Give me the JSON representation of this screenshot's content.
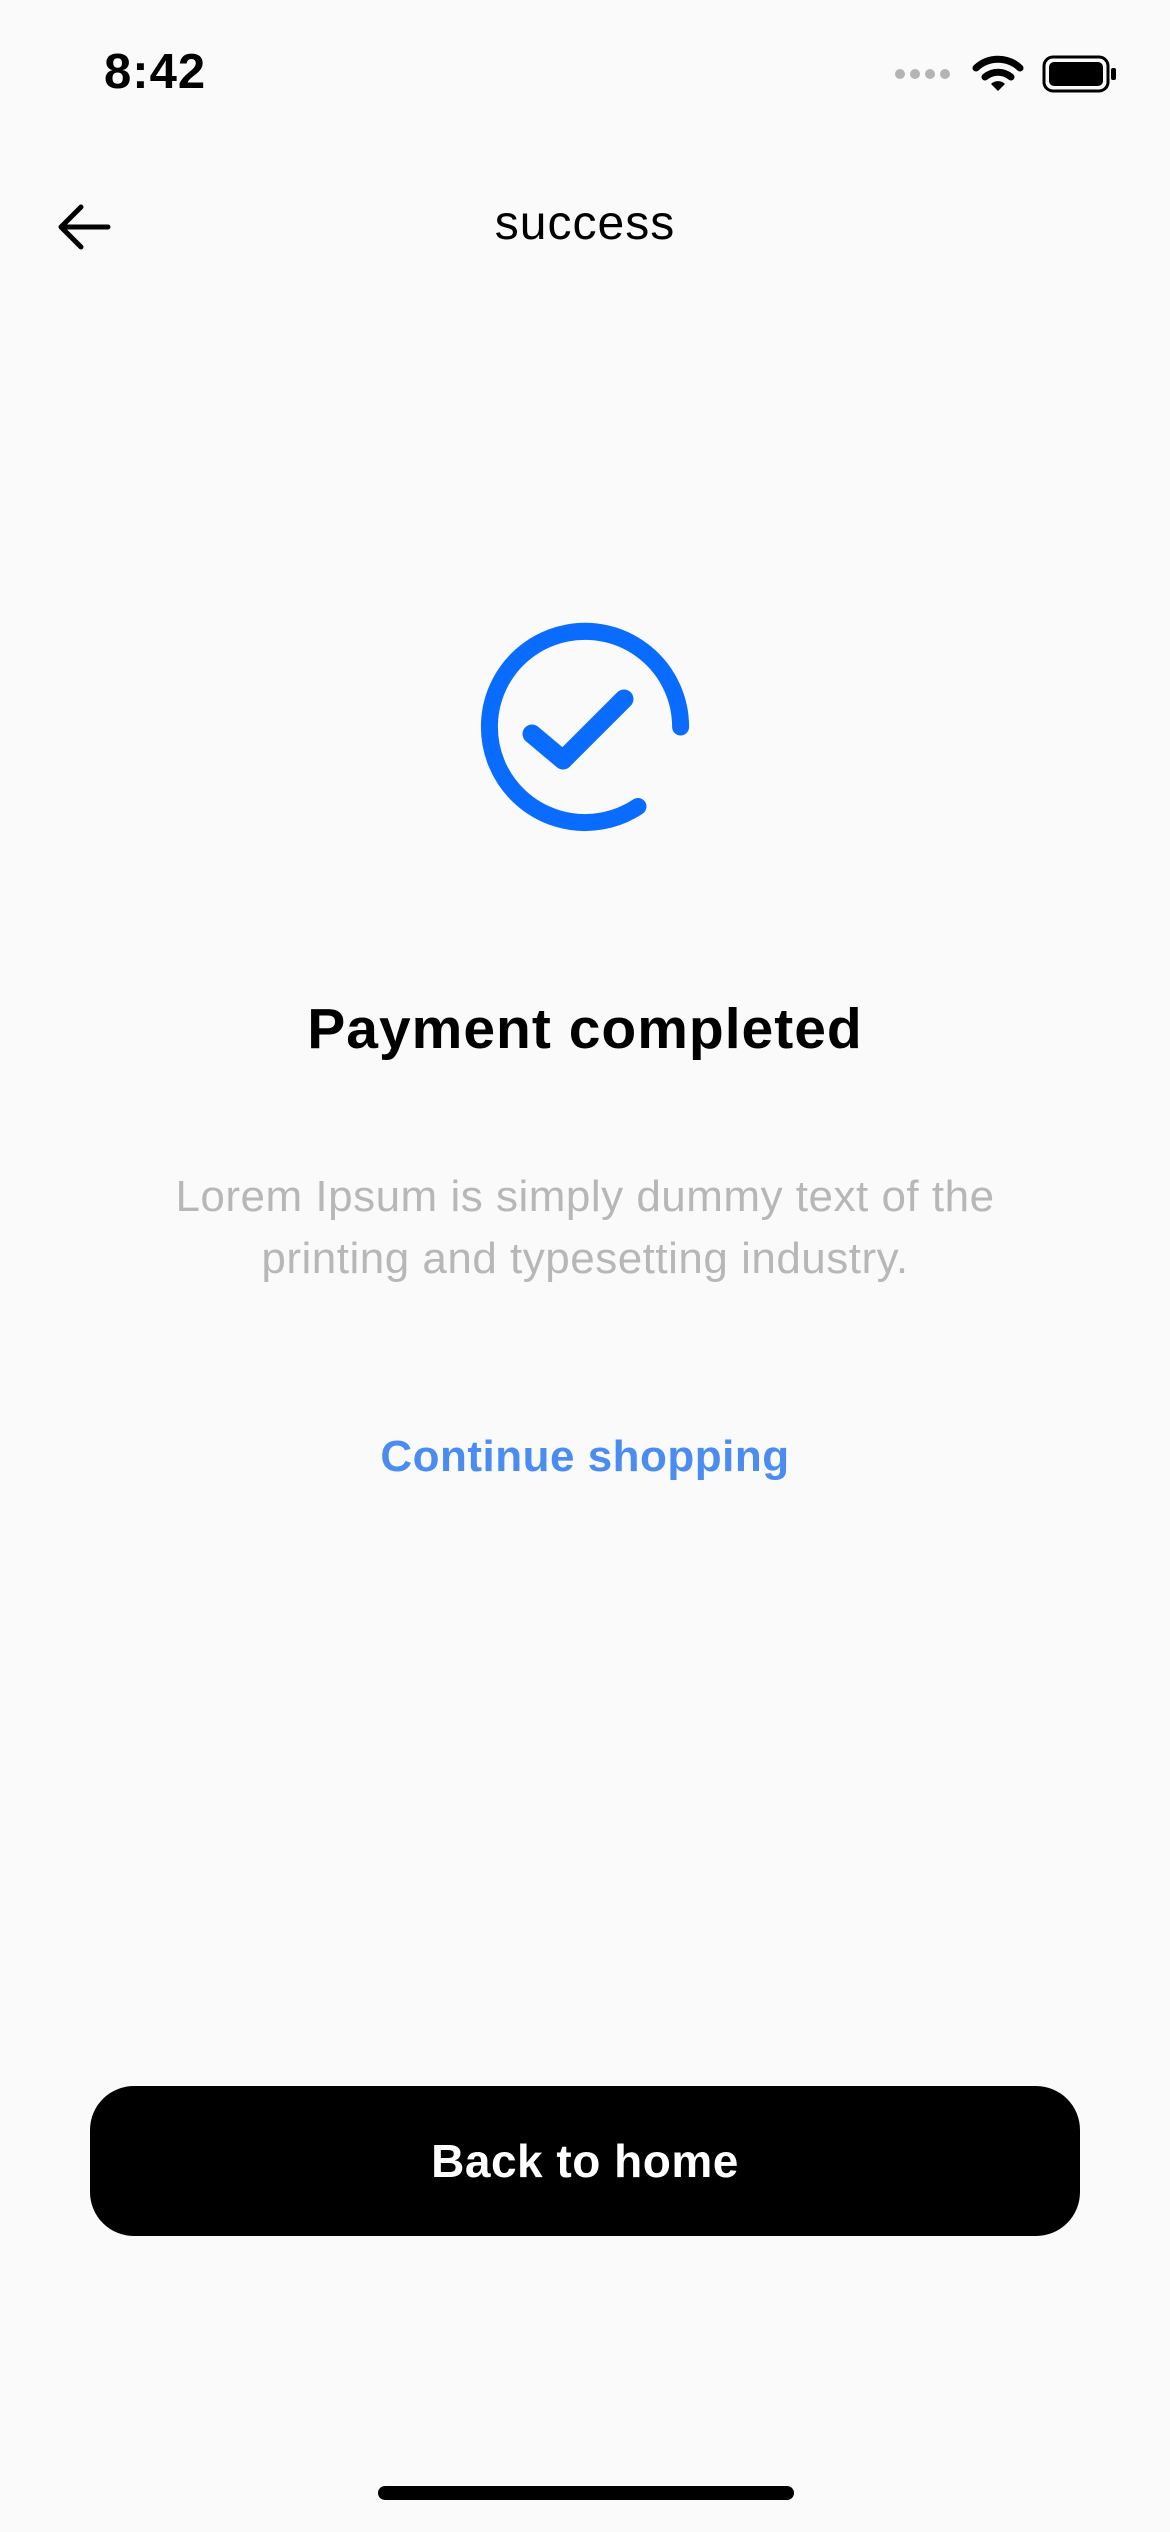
{
  "status_bar": {
    "time": "8:42"
  },
  "nav": {
    "title": "success",
    "back_icon": "arrow-left-icon"
  },
  "success": {
    "icon": "check-circle-icon",
    "icon_color": "#0a6cff",
    "headline": "Payment completed",
    "description": "Lorem Ipsum is simply dummy text of the printing and typesetting industry."
  },
  "actions": {
    "continue_label": "Continue shopping",
    "continue_color": "#4a8cf0",
    "home_button_label": "Back to home"
  }
}
